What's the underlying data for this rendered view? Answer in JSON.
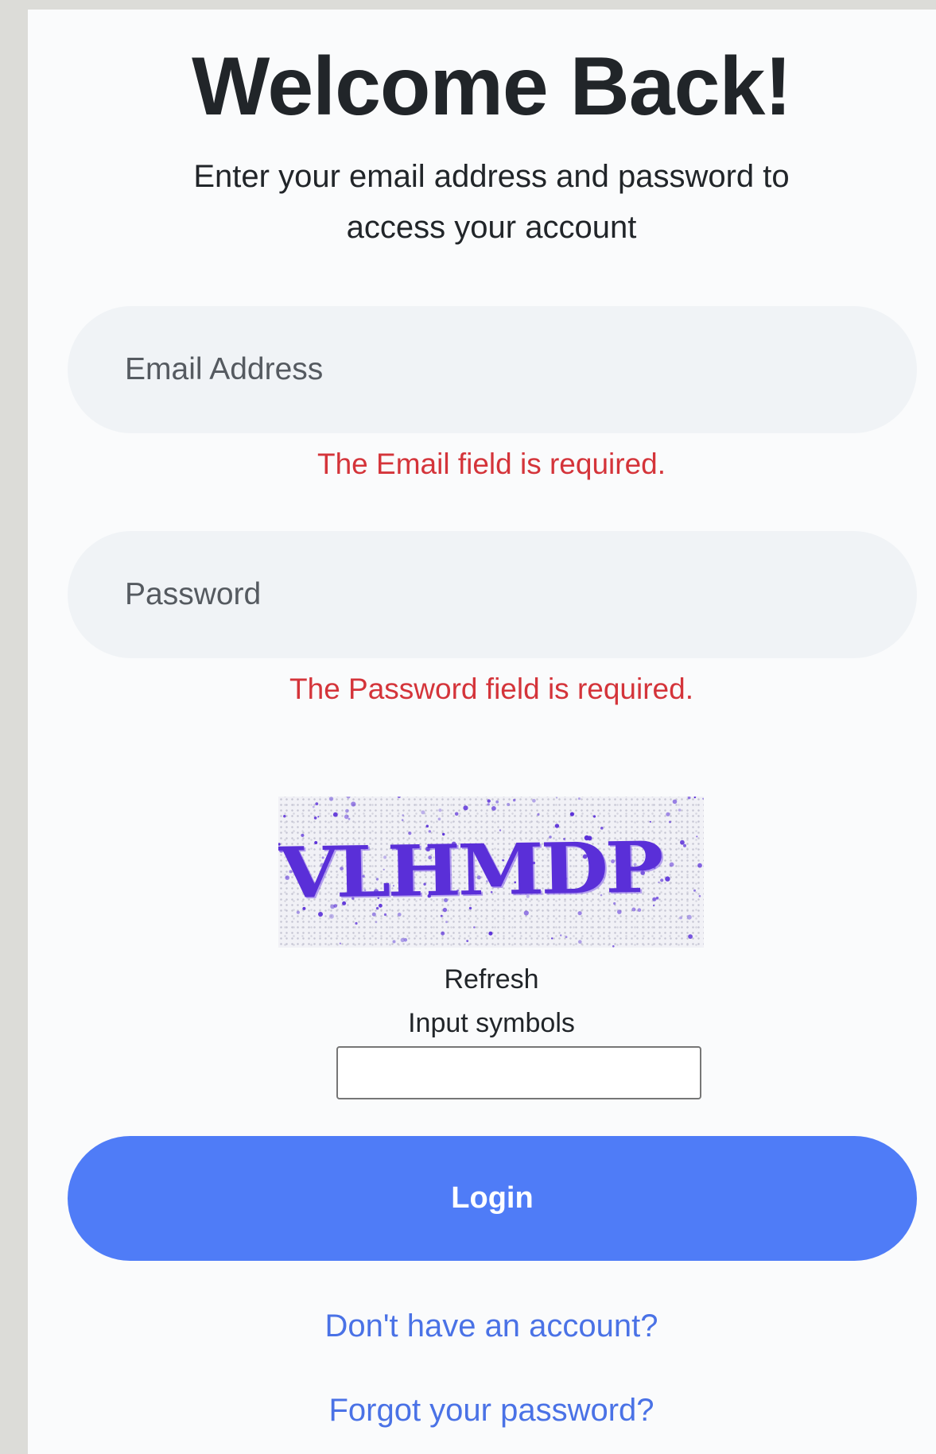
{
  "header": {
    "title": "Welcome Back!",
    "subtitle": "Enter your email address and password to access your account"
  },
  "form": {
    "email": {
      "placeholder": "Email Address",
      "value": "",
      "error": "The Email field is required."
    },
    "password": {
      "placeholder": "Password",
      "value": "",
      "error": "The Password field is required."
    },
    "captcha": {
      "image_text": "VLHMDP",
      "refresh_label": "Refresh",
      "input_label": "Input symbols",
      "value": ""
    },
    "login_label": "Login"
  },
  "links": {
    "signup": "Don't have an account?",
    "forgot": "Forgot your password?"
  },
  "colors": {
    "primary": "#4f7cf7",
    "error": "#d4343a",
    "link": "#4a72e6",
    "input_bg": "#f0f3f6",
    "captcha_text": "#5a2fd8"
  }
}
